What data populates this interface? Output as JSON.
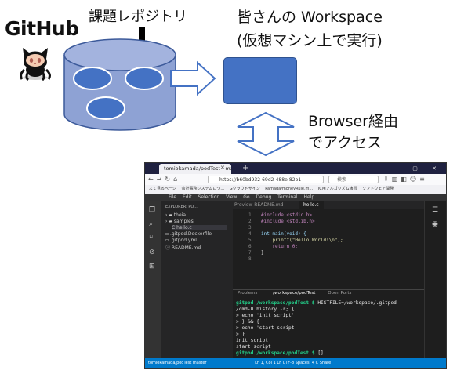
{
  "logo": {
    "text": "GitHub"
  },
  "labels": {
    "repository": "課題レポジトリ",
    "workspace_line1": "皆さんの Workspace",
    "workspace_line2": "(仮想マシン上で実行)",
    "access_line1": "Browser経由",
    "access_line2": "でアクセス"
  },
  "colors": {
    "repo_fill": "#8ea2d4",
    "disk_fill": "#4472c4",
    "workspace_fill": "#4472c4",
    "arrow_outline": "#4472c4"
  },
  "browser": {
    "tab_title": "tomiokamada/podTest - maste",
    "url": "https://b60bd932-69d2-488e-82b1-",
    "search_placeholder": "検索",
    "bookmarks": [
      "よく見るページ",
      "会計事務システムにつ...",
      "Gクラウドサイン",
      "kamada/moneyRule.m...",
      "IC用アルゴリズム演習",
      "ソフトウェア開発"
    ],
    "menu": [
      "File",
      "Edit",
      "Selection",
      "View",
      "Go",
      "Debug",
      "Terminal",
      "Help"
    ],
    "explorer": {
      "title": "EXPLORER: PO...",
      "items": [
        "theia",
        "samples",
        "hello.c",
        ".gitpod.Dockerfile",
        ".gitpod.yml",
        "README.md"
      ]
    },
    "editor_tabs": [
      "Preview README.md",
      "hello.c"
    ],
    "code_lines": [
      "#include <stdio.h>",
      "#include <stdlib.h>",
      "",
      "int main(void) {",
      "    printf(\"Hello World!\\n\");",
      "    return 0;",
      "}",
      ""
    ],
    "line_numbers": [
      "1",
      "2",
      "3",
      "4",
      "5",
      "6",
      "7",
      "8"
    ],
    "terminal_tabs": [
      "Problems",
      "/workspace/podTest",
      "Open Ports"
    ],
    "terminal": {
      "prompt": "gitpod /workspace/podTest $",
      "line1_cmd": "HISTFILE=/workspace/.gitpod",
      "line2": "/cmd-0 history -r; {",
      "line3": "> echo 'init script'",
      "line4": "> } && {",
      "line5": "> echo 'start script'",
      "line6": "> }",
      "line7": "init script",
      "line8": "start script",
      "cursor": "[]"
    },
    "status_left": "tomiokamada/podTest  master",
    "status_right": "Ln 1, Col 1  LF  UTF-8  Spaces: 4  C  Share"
  }
}
